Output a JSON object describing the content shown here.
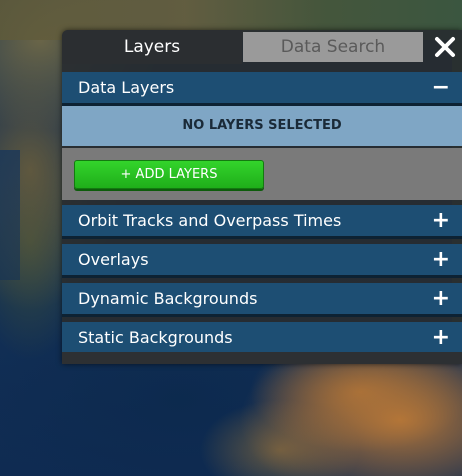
{
  "tabs": {
    "layers": "Layers",
    "data_search": "Data Search"
  },
  "icons": {
    "close": "close-icon",
    "collapse": "minus-icon",
    "expand": "plus-icon"
  },
  "data_layers": {
    "label": "Data Layers",
    "toggle": "−",
    "empty_message": "NO LAYERS SELECTED",
    "add_button": "+ ADD LAYERS"
  },
  "sections": [
    {
      "label": "Orbit Tracks and Overpass Times",
      "toggle": "+"
    },
    {
      "label": "Overlays",
      "toggle": "+"
    },
    {
      "label": "Dynamic Backgrounds",
      "toggle": "+"
    },
    {
      "label": "Static Backgrounds",
      "toggle": "+"
    }
  ],
  "colors": {
    "header_blue": "#1d4e73",
    "empty_band": "#7fa6c5",
    "add_button_green": "#22b81c"
  }
}
